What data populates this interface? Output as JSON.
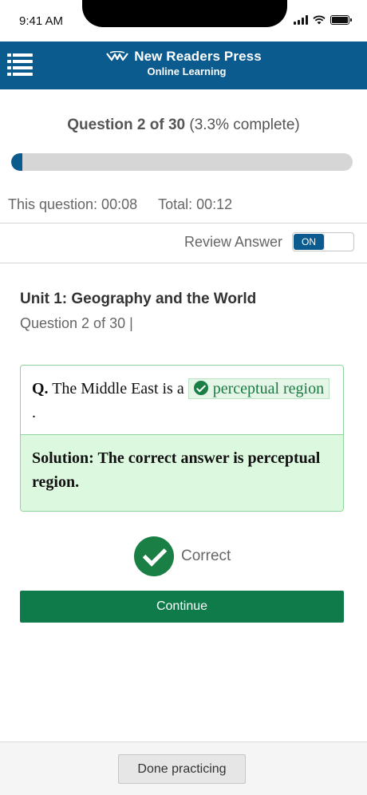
{
  "status_bar": {
    "time": "9:41 AM",
    "icons": [
      "signal-icon",
      "wifi-icon",
      "battery-icon"
    ]
  },
  "header": {
    "brand_name": "New Readers Press",
    "brand_sub": "Online Learning",
    "menu_icon": "hamburger-menu-icon",
    "background_color": "#0b5b8f"
  },
  "progress": {
    "title_bold": "Question 2 of 30",
    "title_rest": "(3.3% complete)",
    "percent": 3.3
  },
  "timers": {
    "question": "This question: 00:08",
    "total": "Total: 00:12"
  },
  "review": {
    "label": "Review Answer",
    "toggle_state": "ON"
  },
  "unit": {
    "title": "Unit 1: Geography and the World",
    "question_count": "Question 2 of 30 |"
  },
  "question": {
    "prefix": "Q.",
    "text": "The Middle East is a",
    "answer": "perceptual region",
    "suffix": ".",
    "solution": "Solution: The correct answer is perceptual region."
  },
  "result": {
    "label": "Correct",
    "icon": "check-circle-icon",
    "color": "#1a7f45"
  },
  "buttons": {
    "continue": "Continue",
    "done": "Done practicing"
  }
}
